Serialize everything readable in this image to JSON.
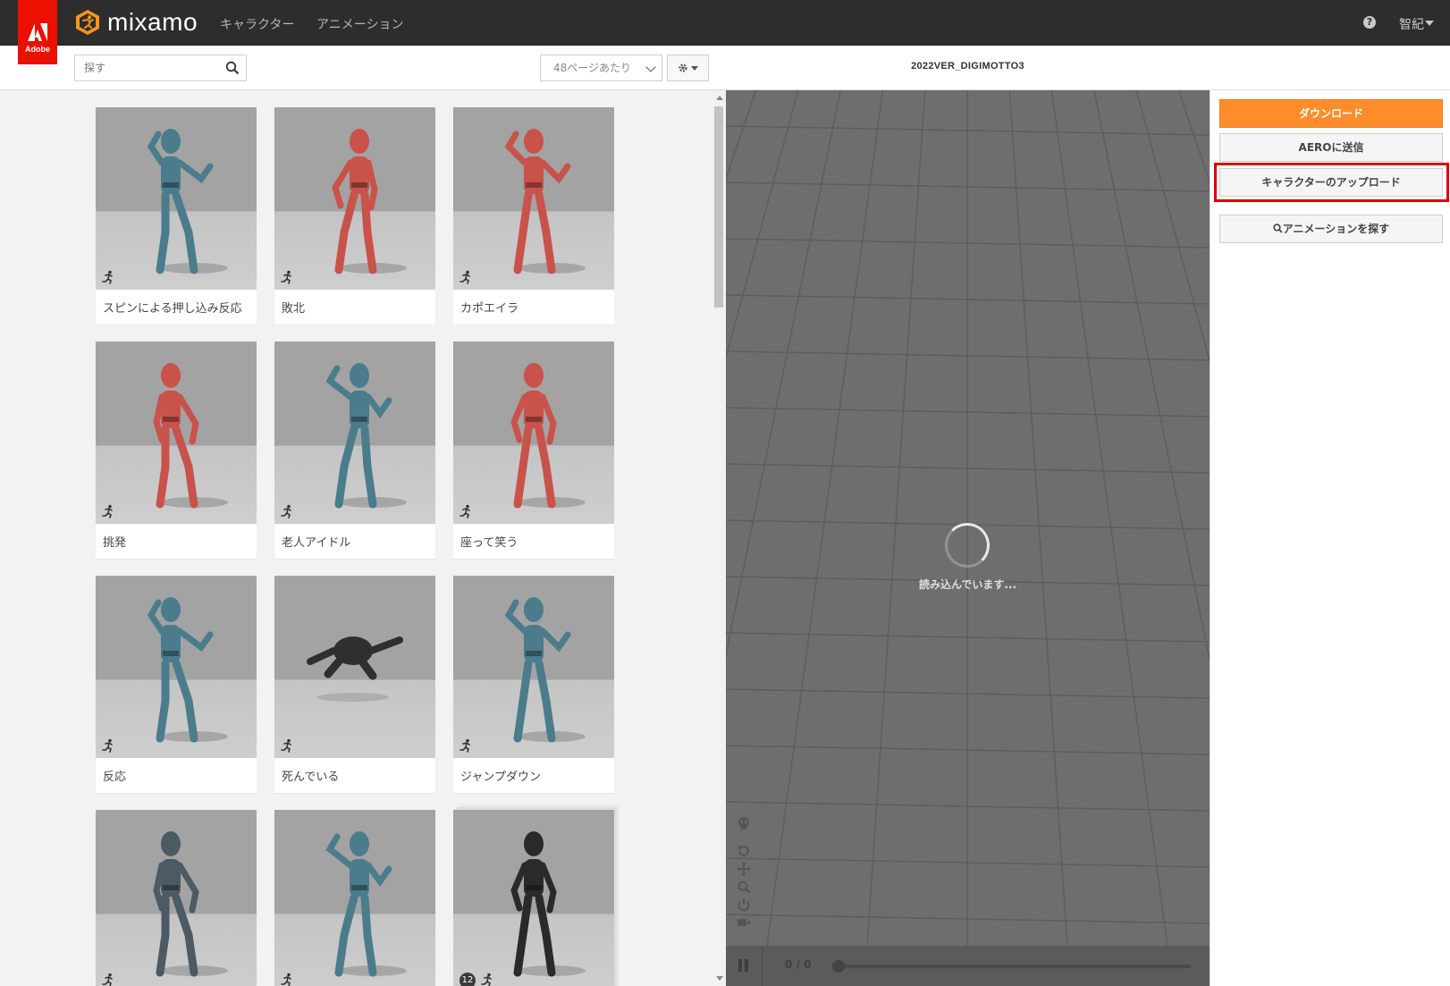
{
  "app": {
    "adobe_label": "Adobe",
    "brand": "mixamo",
    "nav": [
      {
        "label": "キャラクター"
      },
      {
        "label": "アニメーション"
      }
    ],
    "help_glyph": "?",
    "user": "智紀"
  },
  "toolbar": {
    "search_placeholder": "探す",
    "per_page": "48ページあたり"
  },
  "cards": [
    {
      "caption": "スピンによる押し込み反応",
      "figure": "blue"
    },
    {
      "caption": "敗北",
      "figure": "red"
    },
    {
      "caption": "カポエイラ",
      "figure": "red"
    },
    {
      "caption": "挑発",
      "figure": "red"
    },
    {
      "caption": "老人アイドル",
      "figure": "blue"
    },
    {
      "caption": "座って笑う",
      "figure": "red"
    },
    {
      "caption": "反応",
      "figure": "blue"
    },
    {
      "caption": "死んでいる",
      "figure": "dark"
    },
    {
      "caption": "ジャンプダウン",
      "figure": "blue"
    },
    {
      "caption": "",
      "figure": "soldier"
    },
    {
      "caption": "",
      "figure": "blue"
    },
    {
      "caption": "",
      "figure": "ninja",
      "count": "12"
    }
  ],
  "viewer": {
    "character_name": "2022VER_DIGIMOTTO3",
    "loading_text": "読み込んでいます...",
    "frames": "0 / 0"
  },
  "panel": {
    "download": "ダウンロード",
    "send_aero": "AEROに送信",
    "upload_character": "キャラクターのアップロード",
    "find_animation": "アニメーションを探す"
  },
  "colors": {
    "topbar": "#2d2d2d",
    "adobe_red": "#eb1000",
    "primary_orange": "#fe8c2a",
    "highlight_red": "#e00000",
    "figure_blue": "#4a7c8c",
    "figure_red": "#c9524a"
  },
  "icons": [
    "adobe-logo-icon",
    "mixamo-logo-icon",
    "help-icon",
    "search-icon",
    "gear-icon",
    "running-man-icon",
    "skeleton-icon",
    "rotate-icon",
    "move-icon",
    "zoom-icon",
    "power-icon",
    "camera-icon",
    "pause-icon"
  ]
}
